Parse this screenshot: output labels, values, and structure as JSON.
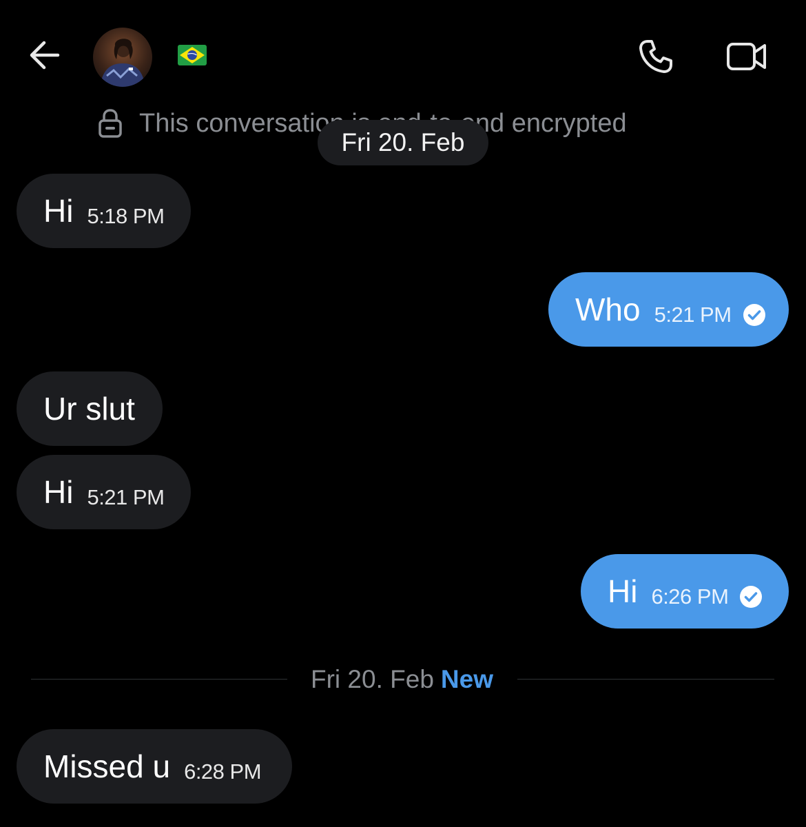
{
  "header": {
    "back_icon": "arrow-left-icon",
    "avatar_icon": "avatar",
    "flag_emoji": "flag-brazil",
    "call_icon": "phone-icon",
    "video_icon": "video-camera-icon"
  },
  "encryption": {
    "icon": "lock-icon",
    "text": "This conversation is end-to-end encrypted"
  },
  "date_pill": "Fri 20. Feb",
  "messages": [
    {
      "direction": "in",
      "text": "Hi",
      "time": "5:18 PM"
    },
    {
      "direction": "out",
      "text": "Who",
      "time": "5:21 PM",
      "status_icon": "sent-check-icon"
    },
    {
      "direction": "in",
      "text": "Ur slut",
      "time": ""
    },
    {
      "direction": "in",
      "text": "Hi",
      "time": "5:21 PM"
    },
    {
      "direction": "out",
      "text": "Hi",
      "time": "6:26 PM",
      "status_icon": "sent-check-icon"
    },
    {
      "direction": "in",
      "text": "Missed u",
      "time": "6:28 PM"
    }
  ],
  "divider": {
    "date": "Fri 20. Feb",
    "label": "New"
  },
  "colors": {
    "background": "#000000",
    "incoming_bubble": "#1c1d20",
    "outgoing_bubble": "#4a99e9",
    "accent": "#4a99e9",
    "muted_text": "#8b8e93"
  }
}
